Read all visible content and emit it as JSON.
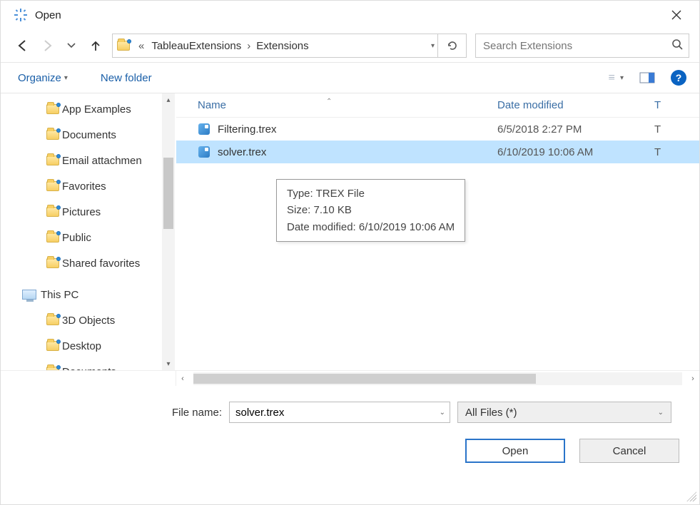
{
  "window": {
    "title": "Open"
  },
  "breadcrumb": {
    "prefix": "«",
    "segments": [
      "TableauExtensions",
      "Extensions"
    ]
  },
  "search": {
    "placeholder": "Search Extensions"
  },
  "toolbar": {
    "organize": "Organize",
    "new_folder": "New folder"
  },
  "tree": {
    "items": [
      {
        "label": "App Examples",
        "level": 1,
        "kind": "folder"
      },
      {
        "label": "Documents",
        "level": 1,
        "kind": "folder"
      },
      {
        "label": "Email attachmen",
        "level": 1,
        "kind": "folder"
      },
      {
        "label": "Favorites",
        "level": 1,
        "kind": "folder"
      },
      {
        "label": "Pictures",
        "level": 1,
        "kind": "folder"
      },
      {
        "label": "Public",
        "level": 1,
        "kind": "folder"
      },
      {
        "label": "Shared favorites",
        "level": 1,
        "kind": "folder"
      },
      {
        "label": "This PC",
        "level": 0,
        "kind": "pc"
      },
      {
        "label": "3D Objects",
        "level": 1,
        "kind": "folder"
      },
      {
        "label": "Desktop",
        "level": 1,
        "kind": "folder"
      },
      {
        "label": "Documents",
        "level": 1,
        "kind": "folder"
      }
    ]
  },
  "columns": {
    "name": "Name",
    "date": "Date modified",
    "type": "T"
  },
  "files": [
    {
      "name": "Filtering.trex",
      "date": "6/5/2018 2:27 PM",
      "type": "T",
      "selected": false
    },
    {
      "name": "solver.trex",
      "date": "6/10/2019 10:06 AM",
      "type": "T",
      "selected": true
    }
  ],
  "tooltip": {
    "line1": "Type: TREX File",
    "line2": "Size: 7.10 KB",
    "line3": "Date modified: 6/10/2019 10:06 AM"
  },
  "footer": {
    "file_name_label": "File name:",
    "file_name_value": "solver.trex",
    "filter": "All Files  (*)",
    "open": "Open",
    "cancel": "Cancel"
  }
}
